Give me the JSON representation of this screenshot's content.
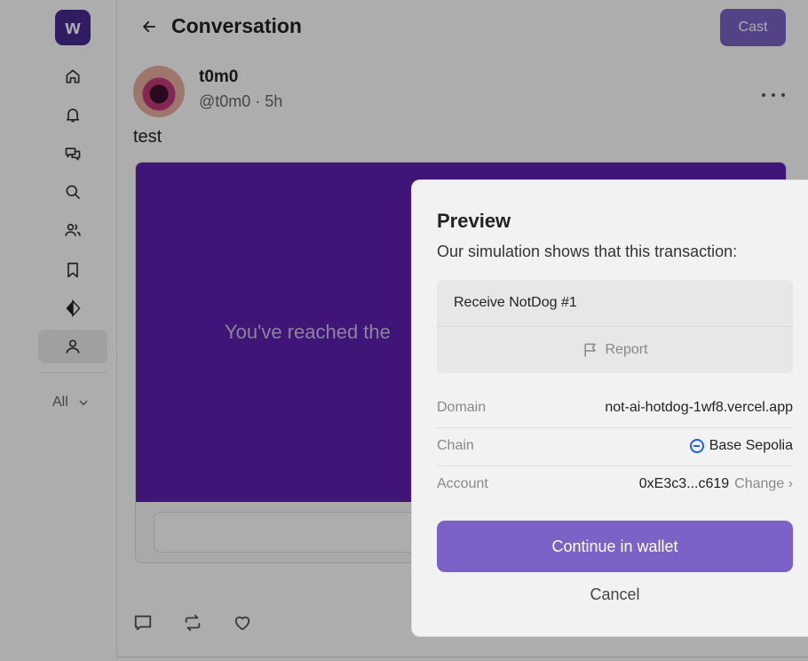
{
  "sidebar": {
    "logo": "w",
    "nav": [
      {
        "id": "home",
        "icon": "home-icon"
      },
      {
        "id": "notifications",
        "icon": "bell-icon"
      },
      {
        "id": "messages",
        "icon": "chat-icon"
      },
      {
        "id": "search",
        "icon": "search-icon"
      },
      {
        "id": "channels",
        "icon": "users-icon"
      },
      {
        "id": "bookmarks",
        "icon": "bookmark-icon"
      },
      {
        "id": "apps",
        "icon": "diamond-icon"
      },
      {
        "id": "profile",
        "icon": "user-icon",
        "active": true
      }
    ],
    "filter_label": "All"
  },
  "header": {
    "title": "Conversation",
    "cast_label": "Cast"
  },
  "post": {
    "author": "t0m0",
    "handle_time": "@t0m0 · 5h",
    "text": "test",
    "frame_text": "You've reached the"
  },
  "modal": {
    "title": "Preview",
    "subtitle": "Our simulation shows that this transaction:",
    "receive": "Receive NotDog #1",
    "report": "Report",
    "rows": {
      "domain": {
        "label": "Domain",
        "value": "not-ai-hotdog-1wf8.vercel.app"
      },
      "chain": {
        "label": "Chain",
        "value": "Base Sepolia"
      },
      "account": {
        "label": "Account",
        "value": "0xE3c3...c619",
        "change": "Change ›"
      }
    },
    "continue_label": "Continue in wallet",
    "cancel_label": "Cancel"
  },
  "colors": {
    "accent": "#7c62c6",
    "logo": "#472a91",
    "frame": "#5d1fb0",
    "chain": "#1f5ef5"
  }
}
